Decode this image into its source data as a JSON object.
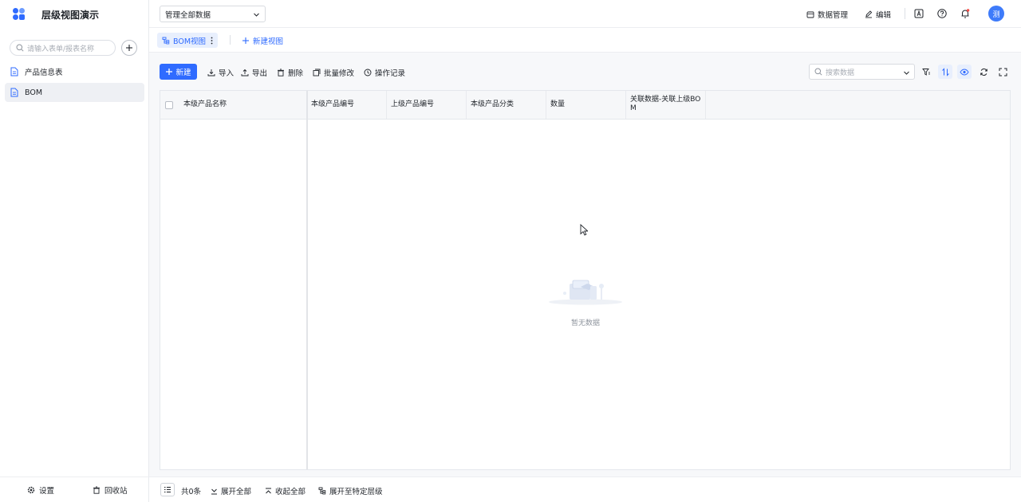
{
  "app": {
    "title": "层级视图演示"
  },
  "sidebar": {
    "search_placeholder": "请输入表单/报表名称",
    "items": [
      {
        "label": "产品信息表",
        "active": false
      },
      {
        "label": "BOM",
        "active": true
      }
    ],
    "footer": {
      "settings": "设置",
      "recycle": "回收站"
    }
  },
  "topbar": {
    "scope": "管理全部数据",
    "data_manage": "数据管理",
    "edit": "编辑",
    "avatar_text": "测"
  },
  "views": {
    "current": "BOM视图",
    "new_view": "新建视图"
  },
  "toolbar": {
    "new": "新建",
    "import": "导入",
    "export": "导出",
    "delete": "删除",
    "batch_edit": "批量修改",
    "log": "操作记录",
    "search_placeholder": "搜索数据"
  },
  "table": {
    "columns": [
      "本级产品名称",
      "本级产品编号",
      "上级产品编号",
      "本级产品分类",
      "数量",
      "关联数据-关联上级BOM"
    ],
    "rows": [],
    "empty_text": "暂无数据"
  },
  "footer": {
    "count": "共0条",
    "expand_all": "展开全部",
    "collapse_all": "收起全部",
    "expand_level": "展开至特定层级"
  },
  "colors": {
    "accent": "#2f6bff",
    "avatar": "#3e7bfa"
  }
}
